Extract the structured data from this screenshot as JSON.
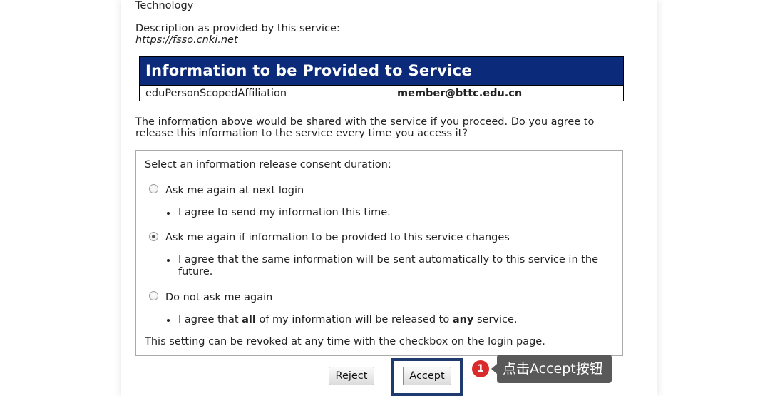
{
  "header": {
    "org_fragment": "Technology",
    "description_label": "Description as provided by this service:",
    "service_url": "https://fsso.cnki.net"
  },
  "info_table": {
    "title": "Information to be Provided to Service",
    "attribute": "eduPersonScopedAffiliation",
    "value": "member@bttc.edu.cn"
  },
  "share_notice": {
    "line1": "The information above would be shared with the service if you proceed. Do you agree to",
    "line2": "release this information to the service every time you access it?"
  },
  "consent": {
    "prompt": "Select an information release consent duration:",
    "options": [
      {
        "label": "Ask me again at next login",
        "checked": false,
        "detail_line1": "I agree to send my information this time.",
        "detail_line2": ""
      },
      {
        "label": "Ask me again if information to be provided to this service changes",
        "checked": true,
        "detail_line1": "I agree that the same information will be sent automatically to this service in the",
        "detail_line2": "future."
      },
      {
        "label": "Do not ask me again",
        "checked": false,
        "detail_part1": "I agree that ",
        "detail_bold1": "all",
        "detail_part2": " of my information will be released to ",
        "detail_bold2": "any",
        "detail_part3": " service."
      }
    ],
    "footer": "This setting can be revoked at any time with the checkbox on the login page."
  },
  "buttons": {
    "reject": "Reject",
    "accept": "Accept"
  },
  "annotation": {
    "badge": "1",
    "tooltip": "点击Accept按钮",
    "badge_color": "#d92b2b",
    "frame_color": "#1e3a6e"
  },
  "colors": {
    "table_header_bg": "#0c2a7a"
  }
}
